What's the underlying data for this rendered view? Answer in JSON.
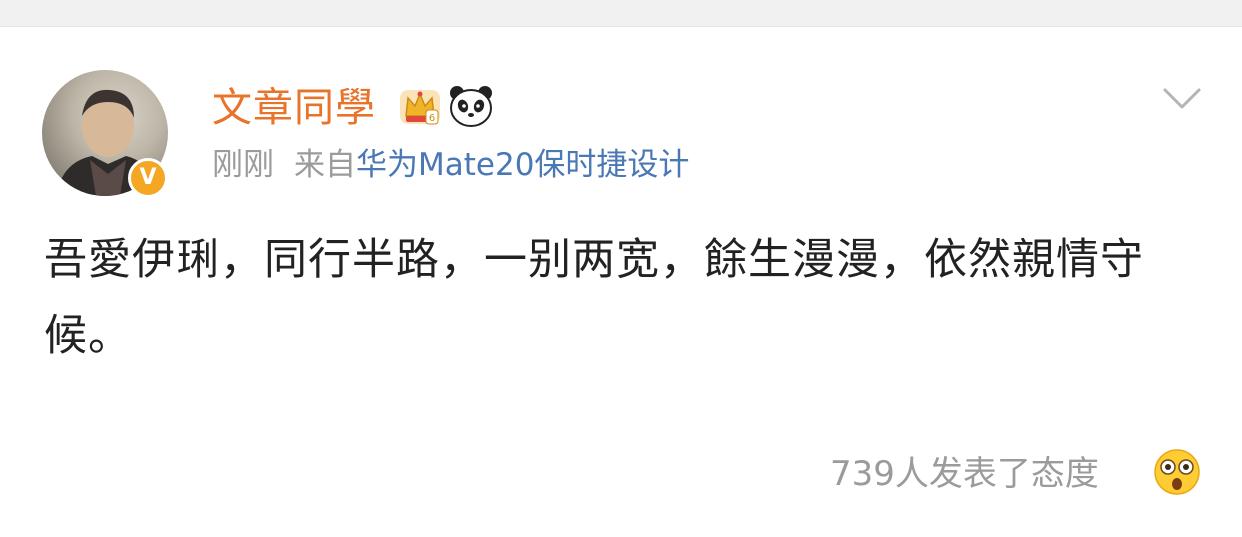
{
  "post": {
    "author": {
      "name": "文章同學",
      "verified_mark": "V"
    },
    "meta": {
      "time": "刚刚",
      "source_prefix": "来自",
      "source": "华为Mate20保时捷设计"
    },
    "text": "吾愛伊琍，同行半路，一别两宽，餘生漫漫，依然親情守候。",
    "reactions": {
      "label": "739人发表了态度"
    }
  },
  "colors": {
    "username": "#e8732b",
    "source_link": "#4a78b5",
    "meta_text": "#9b9b9b",
    "body_text": "#222222",
    "verified_badge": "#f5a623"
  },
  "icons": [
    "crown-icon",
    "panda-icon",
    "chevron-down-icon",
    "verified-badge-icon",
    "surprised-emoji-icon"
  ]
}
